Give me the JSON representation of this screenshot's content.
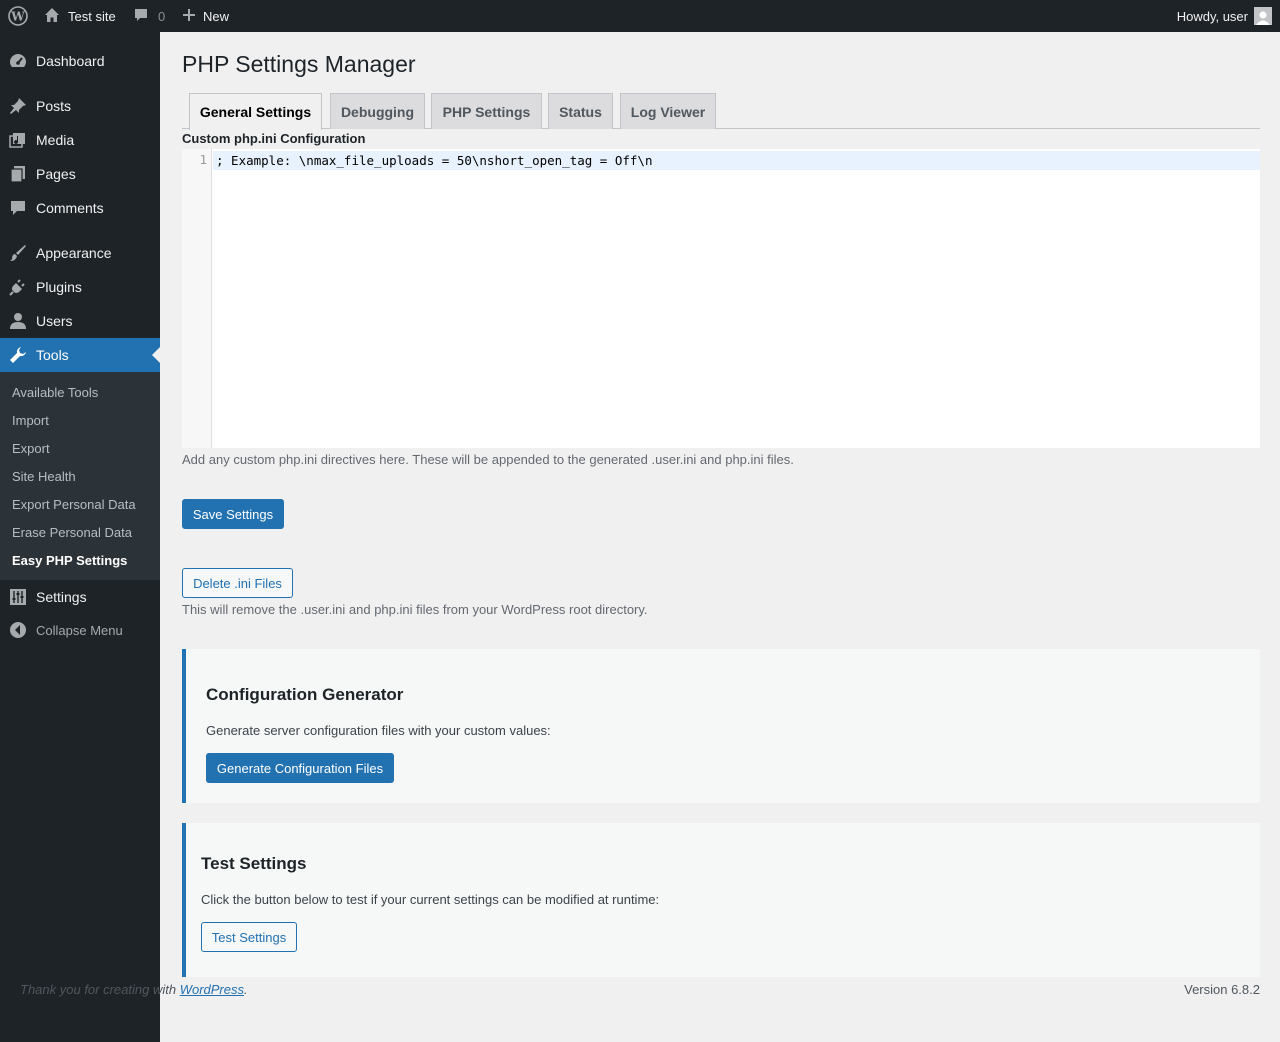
{
  "adminbar": {
    "site_name": "Test site",
    "comments_count": "0",
    "new_label": "New",
    "howdy": "Howdy, user"
  },
  "sidebar": {
    "items": [
      {
        "label": "Dashboard",
        "icon": "dashboard-icon"
      },
      {
        "label": "Posts",
        "icon": "pin-icon"
      },
      {
        "label": "Media",
        "icon": "media-icon"
      },
      {
        "label": "Pages",
        "icon": "pages-icon"
      },
      {
        "label": "Comments",
        "icon": "comment-icon"
      },
      {
        "label": "Appearance",
        "icon": "brush-icon"
      },
      {
        "label": "Plugins",
        "icon": "plug-icon"
      },
      {
        "label": "Users",
        "icon": "user-icon"
      },
      {
        "label": "Tools",
        "icon": "wrench-icon"
      },
      {
        "label": "Settings",
        "icon": "sliders-icon"
      }
    ],
    "submenu": [
      "Available Tools",
      "Import",
      "Export",
      "Site Health",
      "Export Personal Data",
      "Erase Personal Data",
      "Easy PHP Settings"
    ],
    "collapse_label": "Collapse Menu"
  },
  "page": {
    "title": "PHP Settings Manager",
    "tabs": [
      "General Settings",
      "Debugging",
      "PHP Settings",
      "Status",
      "Log Viewer"
    ],
    "active_tab": "General Settings"
  },
  "custom_ini": {
    "label": "Custom php.ini Configuration",
    "line_number": "1",
    "code": "; Example: \\nmax_file_uploads = 50\\nshort_open_tag = Off\\n",
    "description": "Add any custom php.ini directives here. These will be appended to the generated .user.ini and php.ini files."
  },
  "actions": {
    "save_label": "Save Settings",
    "delete_label": "Delete .ini Files",
    "delete_description": "This will remove the .user.ini and php.ini files from your WordPress root directory."
  },
  "generator": {
    "title": "Configuration Generator",
    "text": "Generate server configuration files with your custom values:",
    "button": "Generate Configuration Files"
  },
  "test": {
    "title": "Test Settings",
    "text": "Click the button below to test if your current settings can be modified at runtime:",
    "button": "Test Settings"
  },
  "footer": {
    "thanks_prefix": "Thank you for creating with ",
    "link": "WordPress",
    "suffix": ".",
    "version": "Version 6.8.2"
  },
  "colors": {
    "accent": "#2271b1",
    "sidebar_bg": "#1d2327",
    "submenu_bg": "#2c3338"
  }
}
